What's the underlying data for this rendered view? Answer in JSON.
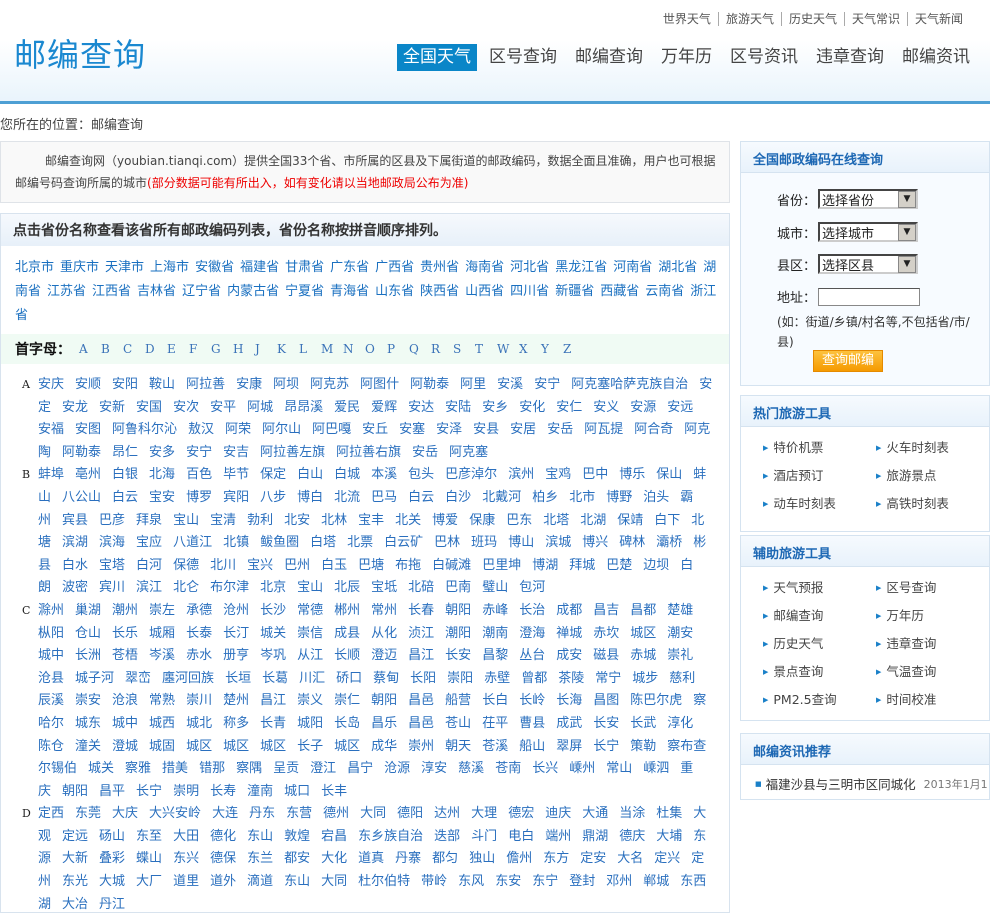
{
  "header": {
    "logo": "邮编查询",
    "top_links": [
      "世界天气",
      "旅游天气",
      "历史天气",
      "天气常识",
      "天气新闻"
    ],
    "nav": [
      "全国天气",
      "区号查询",
      "邮编查询",
      "万年历",
      "区号资讯",
      "违章查询",
      "邮编资讯"
    ],
    "nav_active": 0
  },
  "breadcrumb": "您所在的位置：邮编查询",
  "intro": {
    "text": "邮编查询网（youbian.tianqi.com）提供全国33个省、市所属的区县及下属街道的邮政编码，数据全面且准确，用户也可根据邮编号码查询所属的城市",
    "note": "(部分数据可能有所出入，如有变化请以当地邮政局公布为准)"
  },
  "provinces": {
    "title": "点击省份名称查看该省所有邮政编码列表，省份名称按拼音顺序排列。",
    "items": [
      "北京市",
      "重庆市",
      "天津市",
      "上海市",
      "安徽省",
      "福建省",
      "甘肃省",
      "广东省",
      "广西省",
      "贵州省",
      "海南省",
      "河北省",
      "黑龙江省",
      "河南省",
      "湖北省",
      "湖南省",
      "江苏省",
      "江西省",
      "吉林省",
      "辽宁省",
      "内蒙古省",
      "宁夏省",
      "青海省",
      "山东省",
      "陕西省",
      "山西省",
      "四川省",
      "新疆省",
      "西藏省",
      "云南省",
      "浙江省"
    ]
  },
  "letters": {
    "label": "首字母：",
    "items": [
      "A",
      "B",
      "C",
      "D",
      "E",
      "F",
      "G",
      "H",
      "J",
      "K",
      "L",
      "M",
      "N",
      "O",
      "P",
      "Q",
      "R",
      "S",
      "T",
      "W",
      "X",
      "Y",
      "Z"
    ]
  },
  "cities": [
    {
      "letter": "A",
      "items": [
        "安庆",
        "安顺",
        "安阳",
        "鞍山",
        "阿拉善",
        "安康",
        "阿坝",
        "阿克苏",
        "阿图什",
        "阿勒泰",
        "阿里",
        "安溪",
        "安宁",
        "阿克塞哈萨克族自治",
        "安定",
        "安龙",
        "安新",
        "安国",
        "安次",
        "安平",
        "阿城",
        "昂昂溪",
        "爱民",
        "爱辉",
        "安达",
        "安陆",
        "安乡",
        "安化",
        "安仁",
        "安义",
        "安源",
        "安远",
        "安福",
        "安图",
        "阿鲁科尔沁",
        "敖汉",
        "阿荣",
        "阿尔山",
        "阿巴嘎",
        "安丘",
        "安塞",
        "安泽",
        "安县",
        "安居",
        "安岳",
        "阿瓦提",
        "阿合奇",
        "阿克陶",
        "阿勒泰",
        "昂仁",
        "安多",
        "安宁",
        "安吉",
        "阿拉善左旗",
        "阿拉善右旗",
        "安岳",
        "阿克塞"
      ]
    },
    {
      "letter": "B",
      "items": [
        "蚌埠",
        "亳州",
        "白银",
        "北海",
        "百色",
        "毕节",
        "保定",
        "白山",
        "白城",
        "本溪",
        "包头",
        "巴彦淖尔",
        "滨州",
        "宝鸡",
        "巴中",
        "博乐",
        "保山",
        "蚌山",
        "八公山",
        "白云",
        "宝安",
        "博罗",
        "宾阳",
        "八步",
        "博白",
        "北流",
        "巴马",
        "白云",
        "白沙",
        "北戴河",
        "柏乡",
        "北市",
        "博野",
        "泊头",
        "霸州",
        "宾县",
        "巴彦",
        "拜泉",
        "宝山",
        "宝清",
        "勃利",
        "北安",
        "北林",
        "宝丰",
        "北关",
        "博爱",
        "保康",
        "巴东",
        "北塔",
        "北湖",
        "保靖",
        "白下",
        "北塘",
        "滨湖",
        "滨海",
        "宝应",
        "八道江",
        "北镇",
        "鲅鱼圈",
        "白塔",
        "北票",
        "白云矿",
        "巴林",
        "班玛",
        "博山",
        "滨城",
        "博兴",
        "碑林",
        "灞桥",
        "彬县",
        "白水",
        "宝塔",
        "白河",
        "保德",
        "北川",
        "宝兴",
        "巴州",
        "白玉",
        "巴塘",
        "布拖",
        "白碱滩",
        "巴里坤",
        "博湖",
        "拜城",
        "巴楚",
        "边坝",
        "白朗",
        "波密",
        "宾川",
        "滨江",
        "北仑",
        "布尔津",
        "北京",
        "宝山",
        "北辰",
        "宝坻",
        "北碚",
        "巴南",
        "璧山",
        "包河"
      ]
    },
    {
      "letter": "C",
      "items": [
        "滁州",
        "巢湖",
        "潮州",
        "崇左",
        "承德",
        "沧州",
        "长沙",
        "常德",
        "郴州",
        "常州",
        "长春",
        "朝阳",
        "赤峰",
        "长治",
        "成都",
        "昌吉",
        "昌都",
        "楚雄",
        "枞阳",
        "仓山",
        "长乐",
        "城厢",
        "长泰",
        "长汀",
        "城关",
        "崇信",
        "成县",
        "从化",
        "浈江",
        "潮阳",
        "潮南",
        "澄海",
        "禅城",
        "赤坎",
        "城区",
        "潮安",
        "城中",
        "长洲",
        "苍梧",
        "岑溪",
        "赤水",
        "册亨",
        "岑巩",
        "从江",
        "长顺",
        "澄迈",
        "昌江",
        "长安",
        "昌黎",
        "丛台",
        "成安",
        "磁县",
        "赤城",
        "崇礼",
        "沧县",
        "城子河",
        "翠峦",
        "廛河回族",
        "长垣",
        "长葛",
        "川汇",
        "硚口",
        "蔡甸",
        "长阳",
        "崇阳",
        "赤壁",
        "曾都",
        "茶陵",
        "常宁",
        "城步",
        "慈利",
        "辰溪",
        "崇安",
        "沧浪",
        "常熟",
        "崇川",
        "楚州",
        "昌江",
        "崇义",
        "崇仁",
        "朝阳",
        "昌邑",
        "船营",
        "长白",
        "长岭",
        "长海",
        "昌图",
        "陈巴尔虎",
        "察哈尔",
        "城东",
        "城中",
        "城西",
        "城北",
        "称多",
        "长青",
        "城阳",
        "长岛",
        "昌乐",
        "昌邑",
        "苍山",
        "茌平",
        "曹县",
        "成武",
        "长安",
        "长武",
        "淳化",
        "陈仓",
        "潼关",
        "澄城",
        "城固",
        "城区",
        "城区",
        "城区",
        "长子",
        "城区",
        "成华",
        "崇州",
        "朝天",
        "苍溪",
        "船山",
        "翠屏",
        "长宁",
        "策勒",
        "察布查尔锡伯",
        "城关",
        "察雅",
        "措美",
        "错那",
        "察隅",
        "呈贡",
        "澄江",
        "昌宁",
        "沧源",
        "淳安",
        "慈溪",
        "苍南",
        "长兴",
        "嵊州",
        "常山",
        "嵊泗",
        "重庆",
        "朝阳",
        "昌平",
        "长宁",
        "崇明",
        "长寿",
        "潼南",
        "城口",
        "长丰"
      ]
    },
    {
      "letter": "D",
      "items": [
        "定西",
        "东莞",
        "大庆",
        "大兴安岭",
        "大连",
        "丹东",
        "东营",
        "德州",
        "大同",
        "德阳",
        "达州",
        "大理",
        "德宏",
        "迪庆",
        "大通",
        "当涂",
        "杜集",
        "大观",
        "定远",
        "砀山",
        "东至",
        "大田",
        "德化",
        "东山",
        "敦煌",
        "宕昌",
        "东乡族自治",
        "迭部",
        "斗门",
        "电白",
        "端州",
        "鼎湖",
        "德庆",
        "大埔",
        "东源",
        "大新",
        "叠彩",
        "蝶山",
        "东兴",
        "德保",
        "东兰",
        "都安",
        "大化",
        "道真",
        "丹寨",
        "都匀",
        "独山",
        "儋州",
        "东方",
        "定安",
        "大名",
        "定兴",
        "定州",
        "东光",
        "大城",
        "大厂",
        "道里",
        "道外",
        "滴道",
        "东山",
        "大同",
        "杜尔伯特",
        "带岭",
        "东风",
        "东安",
        "东宁",
        "登封",
        "邓州",
        "郸城",
        "东西湖",
        "大冶",
        "丹江"
      ]
    }
  ],
  "sidebar": {
    "query": {
      "title": "全国邮政编码在线查询",
      "province_label": "省份：",
      "province_value": "选择省份",
      "city_label": "城市：",
      "city_value": "选择城市",
      "county_label": "县区：",
      "county_value": "选择区县",
      "address_label": "地址：",
      "address_value": "",
      "hint": "(如：街道/乡镇/村名等,不包括省/市/县)",
      "button": "查询邮编"
    },
    "hot": {
      "title": "热门旅游工具",
      "items": [
        "特价机票",
        "火车时刻表",
        "酒店预订",
        "旅游景点",
        "动车时刻表",
        "高铁时刻表"
      ]
    },
    "aux": {
      "title": "辅助旅游工具",
      "items": [
        "天气预报",
        "区号查询",
        "邮编查询",
        "万年历",
        "历史天气",
        "违章查询",
        "景点查询",
        "气温查询",
        "PM2.5查询",
        "时间校准"
      ]
    },
    "news": {
      "title": "邮编资讯推荐",
      "items": [
        {
          "title": "福建沙县与三明市区同城化",
          "date": "2013年1月1"
        }
      ]
    }
  }
}
